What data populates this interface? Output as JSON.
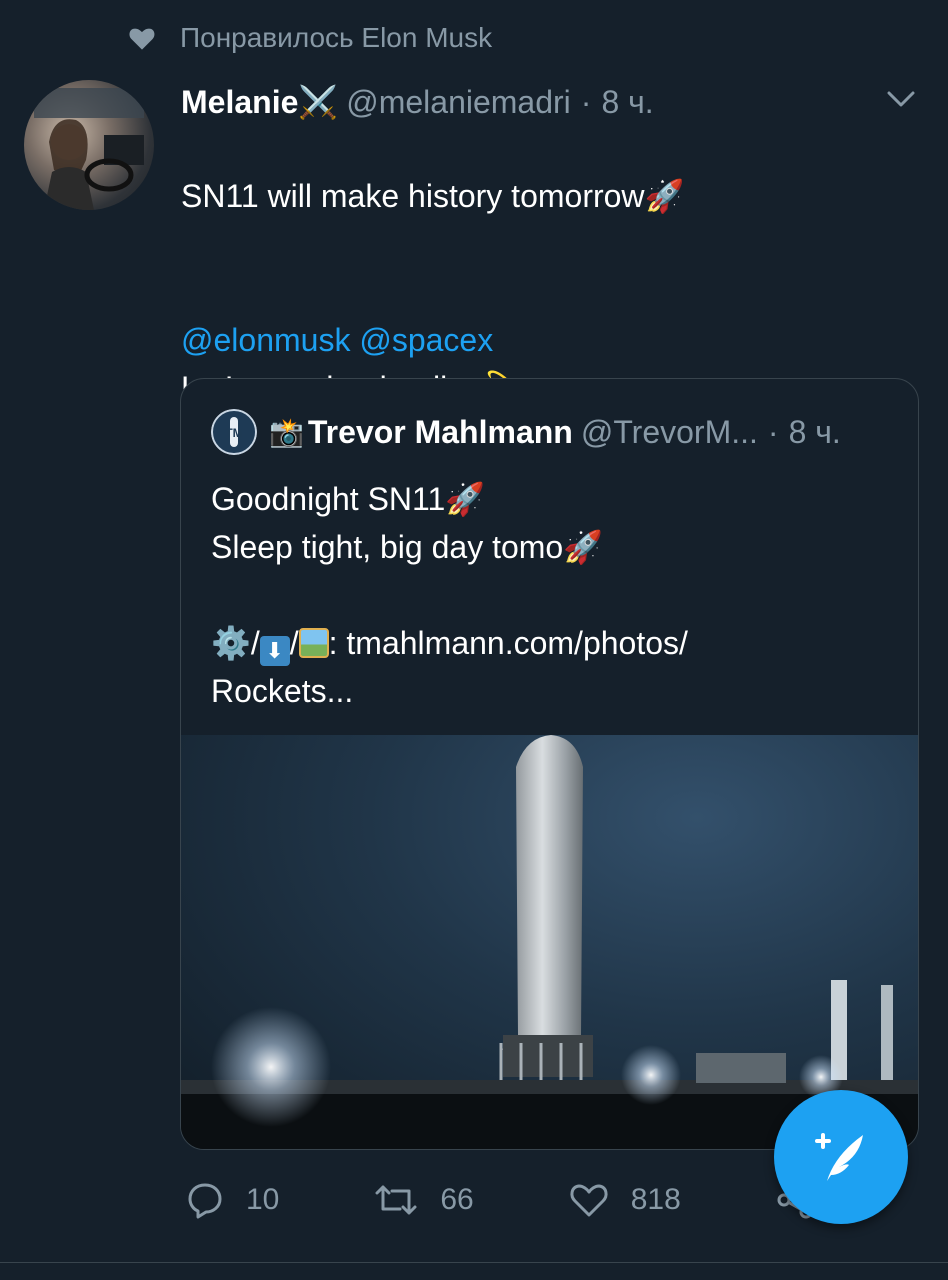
{
  "social_context": {
    "text": "Понравилось Elon Musk"
  },
  "tweet": {
    "display_name": "Melanie",
    "name_emoji": "⚔️",
    "handle": "@melaniemadri",
    "separator": "·",
    "time": "8 ч.",
    "text_line1": "SN11 will make history tomorrow🚀",
    "text_line2": "Let’s see that landing💫",
    "mention1": "@elonmusk",
    "mention2": "@spacex"
  },
  "quote": {
    "name_emoji": "📸",
    "display_name": "Trevor Mahlmann",
    "handle": "@TrevorM...",
    "separator": "·",
    "time": "8 ч.",
    "text": "Goodnight SN11🚀\nSleep tight, big day tomo🚀",
    "icons_suffix": ": tmahlmann.com/photos/",
    "link_cont": "Rockets..."
  },
  "actions": {
    "replies": "10",
    "retweets": "66",
    "likes": "818"
  },
  "colors": {
    "background": "#15202b",
    "accent": "#1da1f2",
    "muted": "#8899a6",
    "border": "#38444d"
  },
  "icons": [
    "heart-icon",
    "chevron-down-icon",
    "reply-icon",
    "retweet-icon",
    "like-icon",
    "share-icon",
    "compose-tweet-icon"
  ]
}
